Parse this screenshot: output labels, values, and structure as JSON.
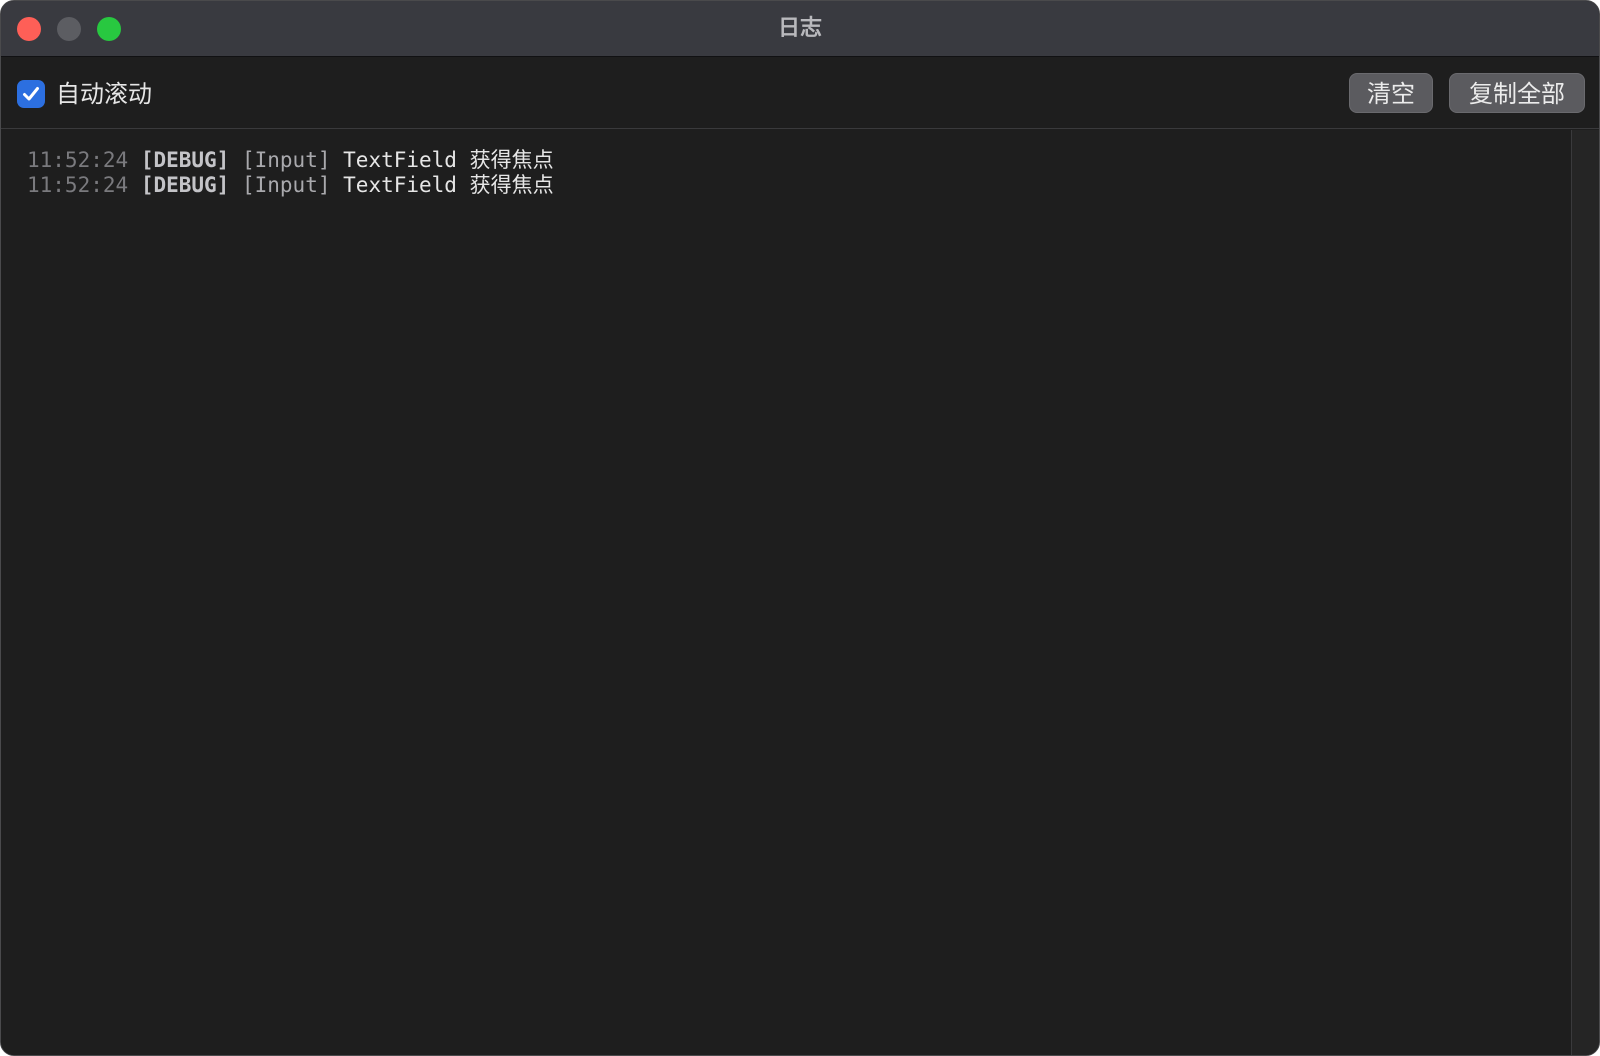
{
  "window": {
    "title": "日志"
  },
  "toolbar": {
    "auto_scroll": {
      "label": "自动滚动",
      "checked": true
    },
    "clear_label": "清空",
    "copy_all_label": "复制全部"
  },
  "logs": [
    {
      "time": "11:52:24",
      "level": "[DEBUG]",
      "source": "[Input]",
      "message": "TextField 获得焦点"
    },
    {
      "time": "11:52:24",
      "level": "[DEBUG]",
      "source": "[Input]",
      "message": "TextField 获得焦点"
    }
  ],
  "colors": {
    "close": "#fe5f57",
    "minimize": "#5c5d62",
    "zoom": "#28c840",
    "accent": "#2c6fe0"
  }
}
